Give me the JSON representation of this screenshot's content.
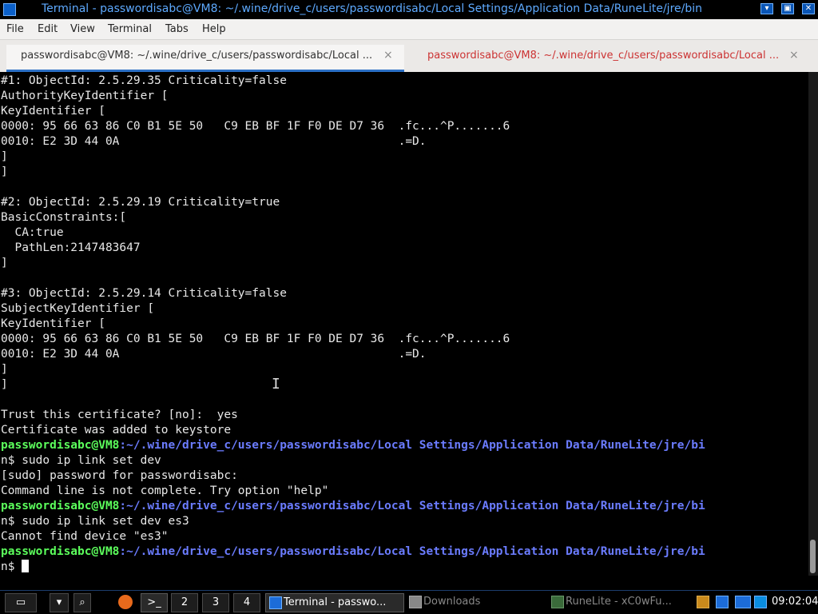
{
  "window": {
    "title": "Terminal - passwordisabc@VM8: ~/.wine/drive_c/users/passwordisabc/Local Settings/Application Data/RuneLite/jre/bin"
  },
  "menu": [
    "File",
    "Edit",
    "View",
    "Terminal",
    "Tabs",
    "Help"
  ],
  "tabs": [
    {
      "label": "passwordisabc@VM8: ~/.wine/drive_c/users/passwordisabc/Local ...",
      "close": "×"
    },
    {
      "label": "passwordisabc@VM8: ~/.wine/drive_c/users/passwordisabc/Local ...",
      "close": "×"
    }
  ],
  "terminal": {
    "lines": [
      "#1: ObjectId: 2.5.29.35 Criticality=false",
      "AuthorityKeyIdentifier [",
      "KeyIdentifier [",
      "0000: 95 66 63 86 C0 B1 5E 50   C9 EB BF 1F F0 DE D7 36  .fc...^P.......6",
      "0010: E2 3D 44 0A                                        .=D.",
      "]",
      "]",
      "",
      "#2: ObjectId: 2.5.29.19 Criticality=true",
      "BasicConstraints:[",
      "  CA:true",
      "  PathLen:2147483647",
      "]",
      "",
      "#3: ObjectId: 2.5.29.14 Criticality=false",
      "SubjectKeyIdentifier [",
      "KeyIdentifier [",
      "0000: 95 66 63 86 C0 B1 5E 50   C9 EB BF 1F F0 DE D7 36  .fc...^P.......6",
      "0010: E2 3D 44 0A                                        .=D.",
      "]",
      "]",
      "",
      "Trust this certificate? [no]:  yes",
      "Certificate was added to keystore",
      "",
      "n$ sudo ip link set dev",
      "[sudo] password for passwordisabc:",
      "Command line is not complete. Try option \"help\"",
      "",
      "n$ sudo ip link set dev es3",
      "Cannot find device \"es3\"",
      "",
      "n$ "
    ],
    "prompt_user": "passwordisabc@VM8",
    "prompt_path": ":~/.wine/drive_c/users/passwordisabc/Local Settings/Application Data/RuneLite/jre/bi"
  },
  "taskbar": {
    "workspaces": [
      "2",
      "3",
      "4"
    ],
    "tasks": [
      "Terminal - passwo...",
      "Downloads",
      "RuneLite - xC0wFu..."
    ],
    "clock": "09:02:04"
  },
  "colors": {
    "prompt_user": "#5cff5c",
    "prompt_path": "#6b7cff",
    "title_text": "#5eaaff",
    "active_tab_underline": "#2b6fc4"
  }
}
